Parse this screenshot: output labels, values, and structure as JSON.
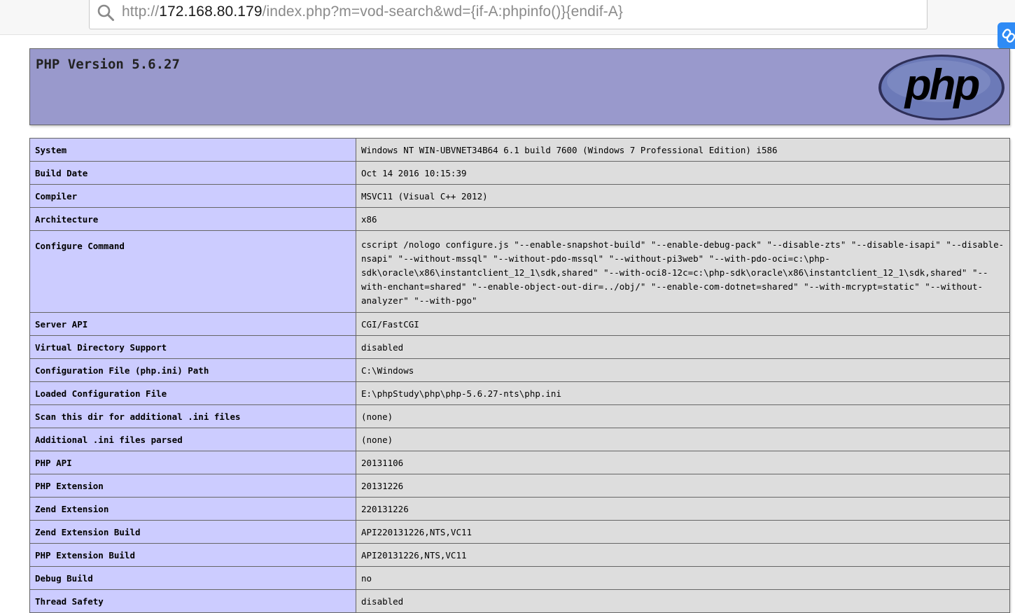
{
  "browser": {
    "url_scheme": "http://",
    "url_host": "172.168.80.179",
    "url_path": "/index.php?m=vod-search&wd={if-A:phpinfo()}{endif-A}"
  },
  "header": {
    "version_title": "PHP Version 5.6.27",
    "logo_text": "php"
  },
  "rows": [
    {
      "key": "System",
      "value": "Windows NT WIN-UBVNET34B64 6.1 build 7600 (Windows 7 Professional Edition) i586"
    },
    {
      "key": "Build Date",
      "value": "Oct 14 2016 10:15:39"
    },
    {
      "key": "Compiler",
      "value": "MSVC11 (Visual C++ 2012)"
    },
    {
      "key": "Architecture",
      "value": "x86"
    },
    {
      "key": "Configure Command",
      "value": "cscript /nologo configure.js \"--enable-snapshot-build\" \"--enable-debug-pack\" \"--disable-zts\" \"--disable-isapi\" \"--disable-nsapi\" \"--without-mssql\" \"--without-pdo-mssql\" \"--without-pi3web\" \"--with-pdo-oci=c:\\php-sdk\\oracle\\x86\\instantclient_12_1\\sdk,shared\" \"--with-oci8-12c=c:\\php-sdk\\oracle\\x86\\instantclient_12_1\\sdk,shared\" \"--with-enchant=shared\" \"--enable-object-out-dir=../obj/\" \"--enable-com-dotnet=shared\" \"--with-mcrypt=static\" \"--without-analyzer\" \"--with-pgo\""
    },
    {
      "key": "Server API",
      "value": "CGI/FastCGI"
    },
    {
      "key": "Virtual Directory Support",
      "value": "disabled"
    },
    {
      "key": "Configuration File (php.ini) Path",
      "value": "C:\\Windows"
    },
    {
      "key": "Loaded Configuration File",
      "value": "E:\\phpStudy\\php\\php-5.6.27-nts\\php.ini"
    },
    {
      "key": "Scan this dir for additional .ini files",
      "value": "(none)"
    },
    {
      "key": "Additional .ini files parsed",
      "value": "(none)"
    },
    {
      "key": "PHP API",
      "value": "20131106"
    },
    {
      "key": "PHP Extension",
      "value": "20131226"
    },
    {
      "key": "Zend Extension",
      "value": "220131226"
    },
    {
      "key": "Zend Extension Build",
      "value": "API220131226,NTS,VC11"
    },
    {
      "key": "PHP Extension Build",
      "value": "API20131226,NTS,VC11"
    },
    {
      "key": "Debug Build",
      "value": "no"
    },
    {
      "key": "Thread Safety",
      "value": "disabled"
    }
  ],
  "colors": {
    "header_bg": "#9999cc",
    "key_cell_bg": "#ccccff",
    "value_cell_bg": "#dddddd",
    "badge_blue": "#2f8bf5"
  },
  "icons": {
    "address_bar": "search-icon",
    "side_badge": "link-icon"
  }
}
